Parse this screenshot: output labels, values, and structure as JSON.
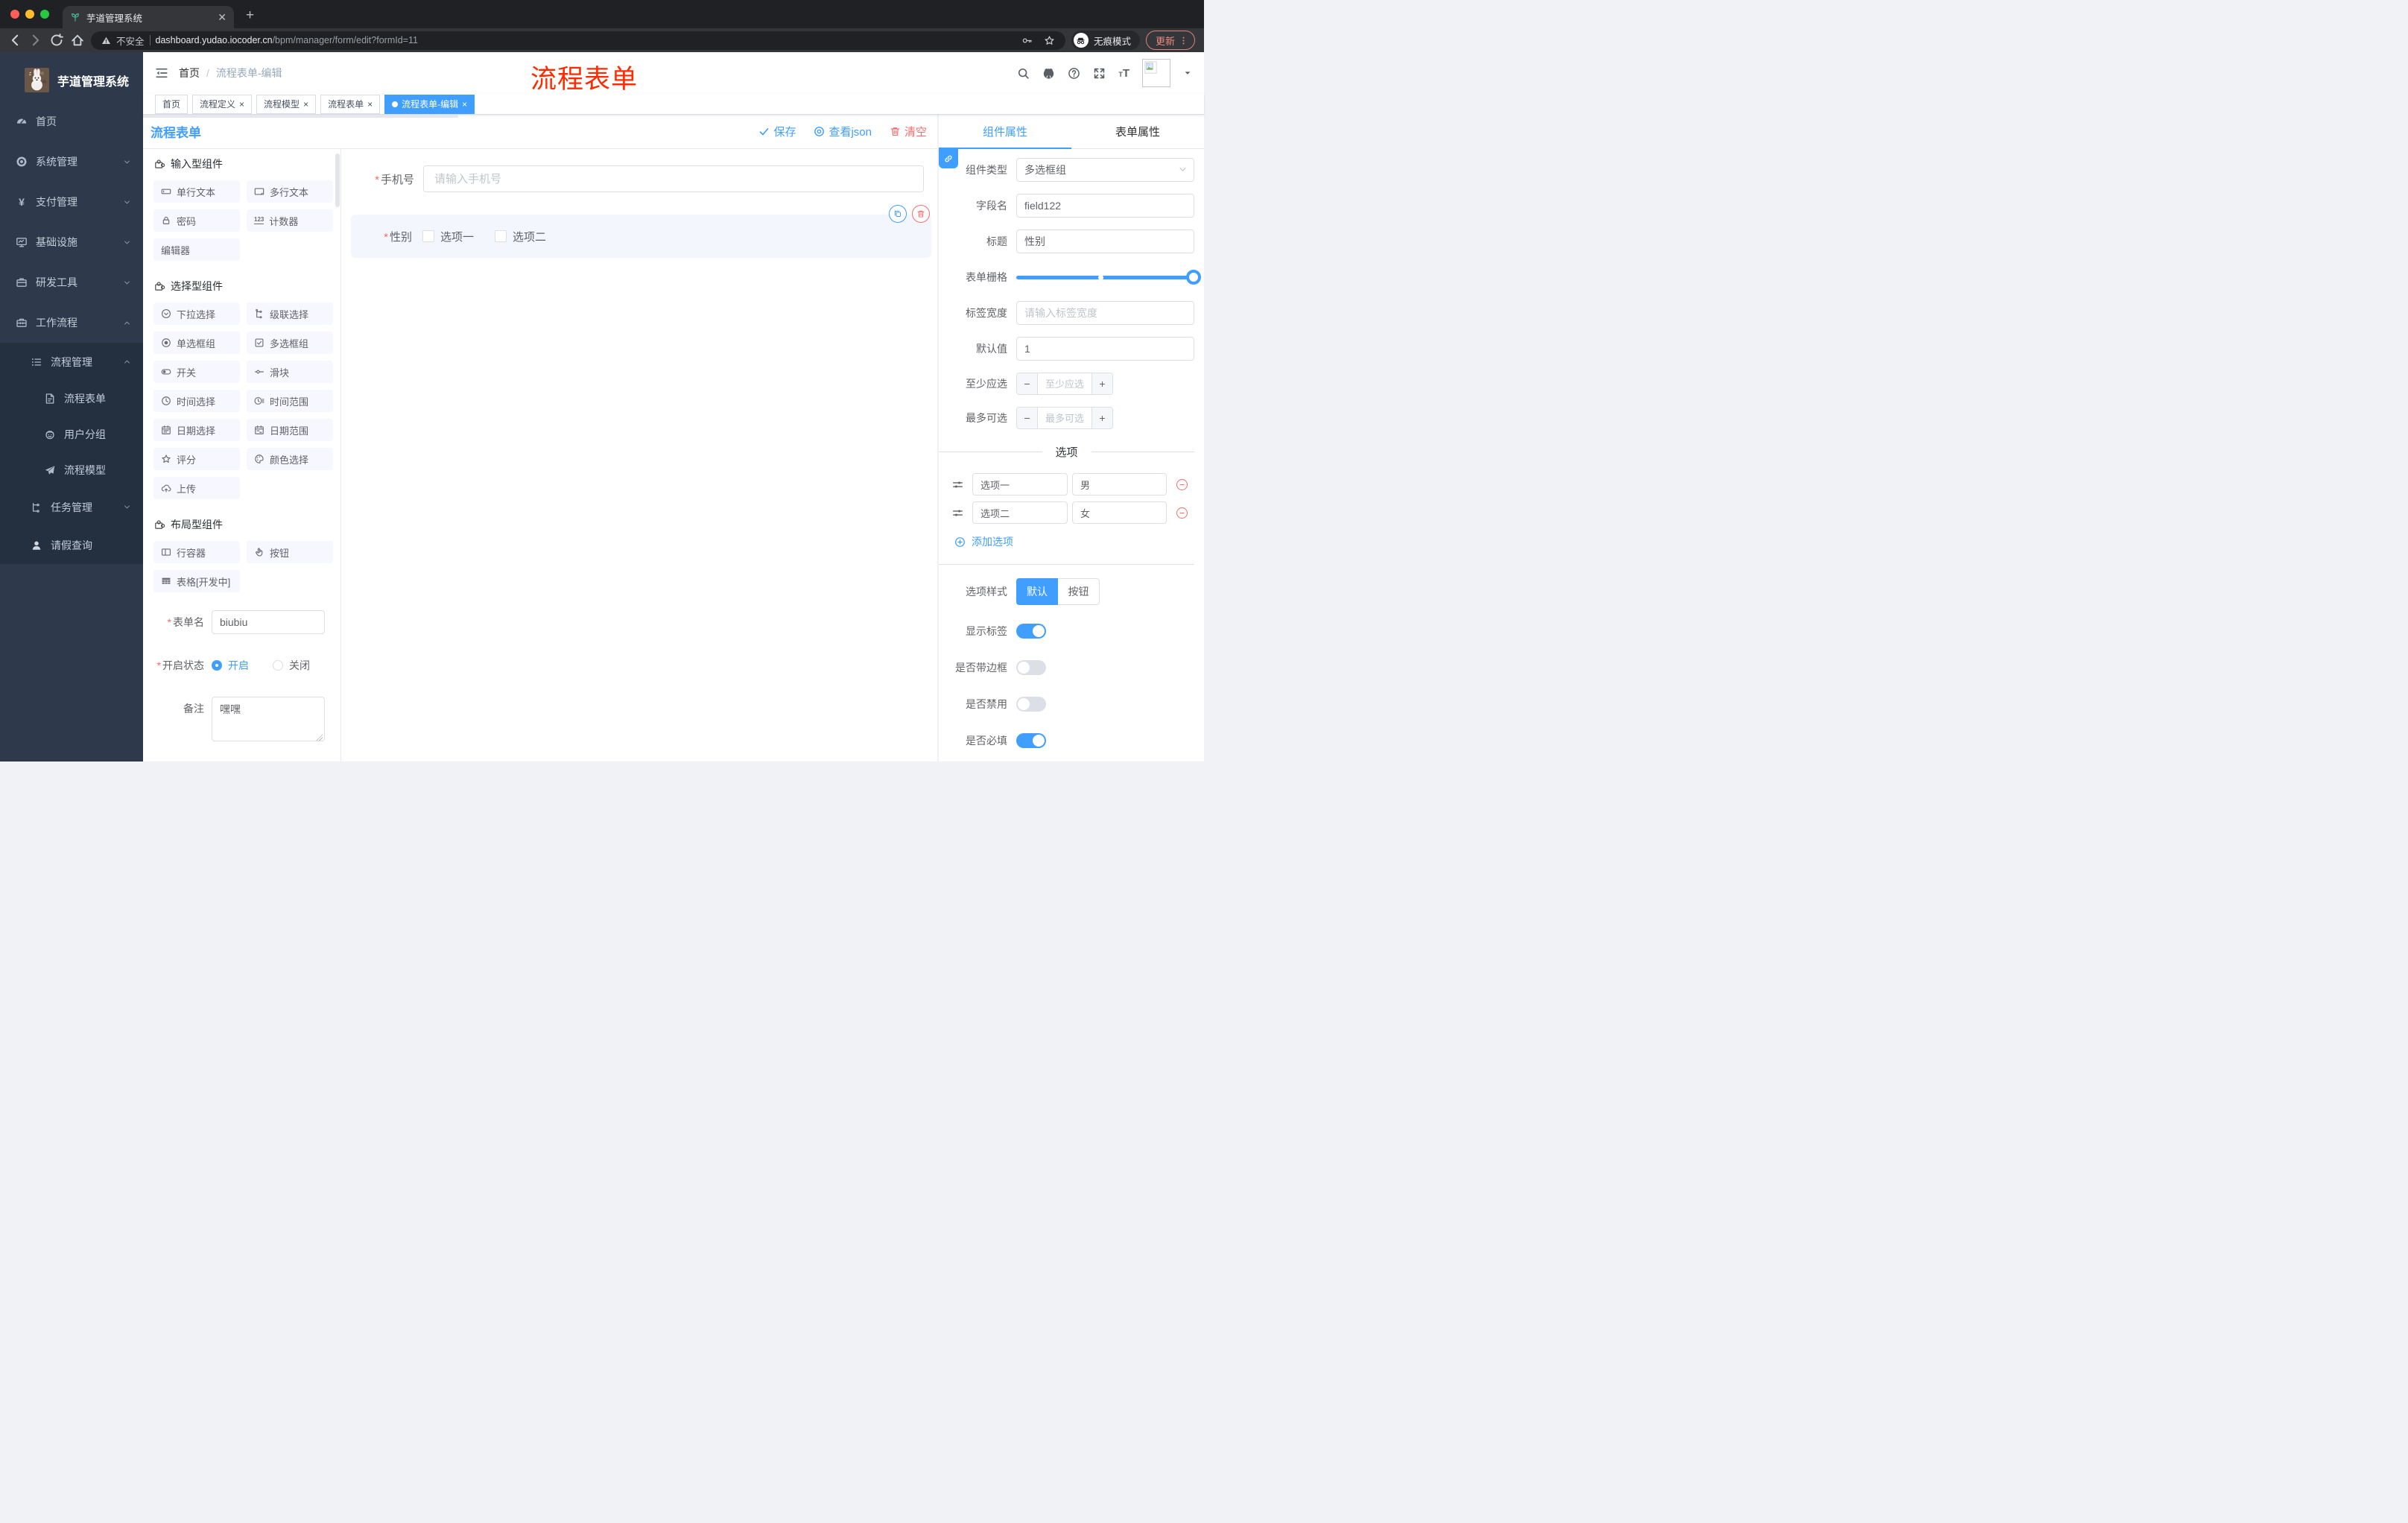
{
  "colors": {
    "accent": "#409eff",
    "danger": "#f56c6c",
    "annotation": "#ff2b00"
  },
  "browser": {
    "tab_title": "芋道管理系统",
    "security_label": "不安全",
    "url_host": "dashboard.yudao.iocoder.cn",
    "url_path": "/bpm/manager/form/edit?formId=11",
    "incognito_label": "无痕模式",
    "update_label": "更新"
  },
  "sidebar": {
    "logo_title": "芋道管理系统",
    "menu": [
      {
        "label": "首页",
        "icon": "dashboard-icon",
        "level": 1,
        "chevron": "",
        "dark": false
      },
      {
        "label": "系统管理",
        "icon": "gear-icon",
        "level": 1,
        "chevron": "down",
        "dark": false
      },
      {
        "label": "支付管理",
        "icon": "yen-icon",
        "level": 1,
        "chevron": "down",
        "dark": false
      },
      {
        "label": "基础设施",
        "icon": "monitor-icon",
        "level": 1,
        "chevron": "down",
        "dark": false
      },
      {
        "label": "研发工具",
        "icon": "briefcase-icon",
        "level": 1,
        "chevron": "down",
        "dark": false
      },
      {
        "label": "工作流程",
        "icon": "toolbox-icon",
        "level": 1,
        "chevron": "up",
        "dark": false
      },
      {
        "label": "流程管理",
        "icon": "list-tree-icon",
        "level": 2,
        "chevron": "up",
        "dark": true
      },
      {
        "label": "流程表单",
        "icon": "document-edit-icon",
        "level": 3,
        "chevron": "",
        "dark": true
      },
      {
        "label": "用户分组",
        "icon": "face-icon",
        "level": 3,
        "chevron": "",
        "dark": true
      },
      {
        "label": "流程模型",
        "icon": "paper-plane-icon",
        "level": 3,
        "chevron": "",
        "dark": true
      },
      {
        "label": "任务管理",
        "icon": "org-tree-icon",
        "level": 2,
        "chevron": "down",
        "dark": true
      },
      {
        "label": "请假查询",
        "icon": "person-icon",
        "level": 2,
        "chevron": "",
        "dark": true
      }
    ]
  },
  "header": {
    "breadcrumb_home": "首页",
    "breadcrumb_current": "流程表单-编辑",
    "annotation": "流程表单",
    "icons": [
      "search-icon",
      "github-icon",
      "question-icon",
      "fullscreen-icon"
    ]
  },
  "tags": [
    {
      "label": "首页",
      "closable": false,
      "active": false
    },
    {
      "label": "流程定义",
      "closable": true,
      "active": false
    },
    {
      "label": "流程模型",
      "closable": true,
      "active": false
    },
    {
      "label": "流程表单",
      "closable": true,
      "active": false
    },
    {
      "label": "流程表单-编辑",
      "closable": true,
      "active": true
    }
  ],
  "designer": {
    "title": "流程表单",
    "actions": {
      "save": "保存",
      "view_json": "查看json",
      "clear": "清空"
    },
    "sections": [
      {
        "title": "输入型组件",
        "items": [
          {
            "label": "单行文本",
            "icon": "input-icon"
          },
          {
            "label": "多行文本",
            "icon": "textarea-icon"
          },
          {
            "label": "密码",
            "icon": "lock-icon"
          },
          {
            "label": "计数器",
            "icon": "counter-icon"
          },
          {
            "label": "编辑器",
            "icon": ""
          }
        ]
      },
      {
        "title": "选择型组件",
        "items": [
          {
            "label": "下拉选择",
            "icon": "select-icon"
          },
          {
            "label": "级联选择",
            "icon": "cascader-icon"
          },
          {
            "label": "单选框组",
            "icon": "radio-icon"
          },
          {
            "label": "多选框组",
            "icon": "checkbox-icon"
          },
          {
            "label": "开关",
            "icon": "switch-icon"
          },
          {
            "label": "滑块",
            "icon": "slider-icon"
          },
          {
            "label": "时间选择",
            "icon": "time-icon"
          },
          {
            "label": "时间范围",
            "icon": "time-range-icon"
          },
          {
            "label": "日期选择",
            "icon": "date-icon"
          },
          {
            "label": "日期范围",
            "icon": "date-range-icon"
          },
          {
            "label": "评分",
            "icon": "star-icon"
          },
          {
            "label": "颜色选择",
            "icon": "color-icon"
          },
          {
            "label": "上传",
            "icon": "upload-icon"
          }
        ]
      },
      {
        "title": "布局型组件",
        "items": [
          {
            "label": "行容器",
            "icon": "row-icon"
          },
          {
            "label": "按钮",
            "icon": "button-icon"
          },
          {
            "label": "表格[开发中]",
            "icon": "table-icon"
          }
        ]
      }
    ],
    "form": {
      "name_label": "表单名",
      "name_value": "biubiu",
      "status_label": "开启状态",
      "status_on": "开启",
      "status_off": "关闭",
      "remark_label": "备注",
      "remark_value": "嘿嘿"
    },
    "canvas": {
      "phone_label": "手机号",
      "phone_placeholder": "请输入手机号",
      "gender_label": "性别",
      "gender_options": [
        "选项一",
        "选项二"
      ]
    }
  },
  "props": {
    "tab_component": "组件属性",
    "tab_form": "表单属性",
    "component_type_label": "组件类型",
    "component_type_value": "多选框组",
    "field_name_label": "字段名",
    "field_name_value": "field122",
    "title_label": "标题",
    "title_value": "性别",
    "grid_label": "表单栅格",
    "grid_value_percent": 100,
    "grid_mark_percent": 46,
    "label_width_label": "标签宽度",
    "label_width_placeholder": "请输入标签宽度",
    "default_label": "默认值",
    "default_value": "1",
    "min_label": "至少应选",
    "min_placeholder": "至少应选",
    "max_label": "最多可选",
    "max_placeholder": "最多可选",
    "options_title": "选项",
    "options": [
      {
        "label": "选项一",
        "value": "男"
      },
      {
        "label": "选项二",
        "value": "女"
      }
    ],
    "add_option": "添加选项",
    "style_label": "选项样式",
    "style_default": "默认",
    "style_button": "按钮",
    "switches": [
      {
        "label": "显示标签",
        "on": true
      },
      {
        "label": "是否带边框",
        "on": false
      },
      {
        "label": "是否禁用",
        "on": false
      },
      {
        "label": "是否必填",
        "on": true
      }
    ]
  }
}
